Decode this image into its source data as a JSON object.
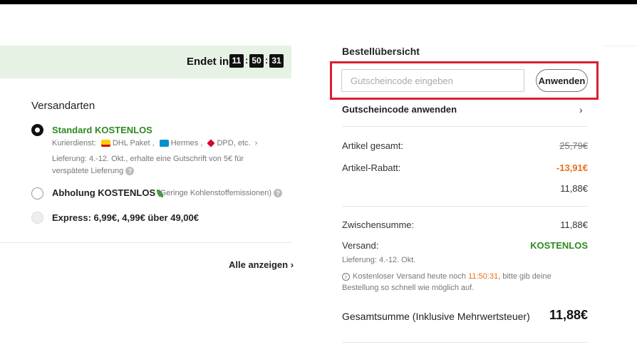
{
  "timer": {
    "label": "Endet in",
    "hours": "11",
    "minutes": "50",
    "seconds": "31",
    "separator": ":"
  },
  "shipping": {
    "title": "Versandarten",
    "options": [
      {
        "title": "Standard KOSTENLOS",
        "carriers_label": "Kurierdienst:",
        "carriers": [
          "DHL Paket ,",
          "Hermes ,",
          "DPD",
          ", etc."
        ],
        "delivery_line1": "Lieferung: 4.-12. Okt., erhalte eine Gutschrift von 5€ für",
        "delivery_line2": "verspätete Lieferung",
        "selected": true
      },
      {
        "title": "Abholung KOSTENLOS",
        "note": "(Geringe Kohlenstoffemissionen)",
        "selected": false
      },
      {
        "title": "Express: 6,99€, 4,99€ über 49,00€",
        "selected": false,
        "disabled": true
      }
    ],
    "show_all": "Alle anzeigen",
    "show_all_chevron": "›"
  },
  "summary": {
    "title": "Bestellübersicht",
    "coupon_placeholder": "Gutscheincode eingeben",
    "apply_label": "Anwenden",
    "coupon_link": "Gutscheincode anwenden",
    "chevron": "›",
    "items_total_label": "Artikel gesamt:",
    "items_total_value": "25,79€",
    "items_discount_label": "Artikel-Rabatt:",
    "items_discount_value": "-13,91€",
    "items_net_value": "11,88€",
    "subtotal_label": "Zwischensumme:",
    "subtotal_value": "11,88€",
    "shipping_label": "Versand:",
    "shipping_value": "KOSTENLOS",
    "shipping_delivery": "Lieferung: 4.-12. Okt.",
    "note_prefix": "Kostenloser Versand heute noch",
    "note_timer": "11:50:31",
    "note_suffix": ", bitte gib deine Bestellung so schnell wie möglich auf.",
    "grand_total_label": "Gesamtsumme (Inklusive Mehrwertsteuer)",
    "grand_total_value": "11,88€"
  },
  "colors": {
    "accent_green": "#2e8b22",
    "discount_orange": "#e8701a",
    "highlight_red": "#d9202f",
    "banner_green": "#e6f3e4"
  }
}
